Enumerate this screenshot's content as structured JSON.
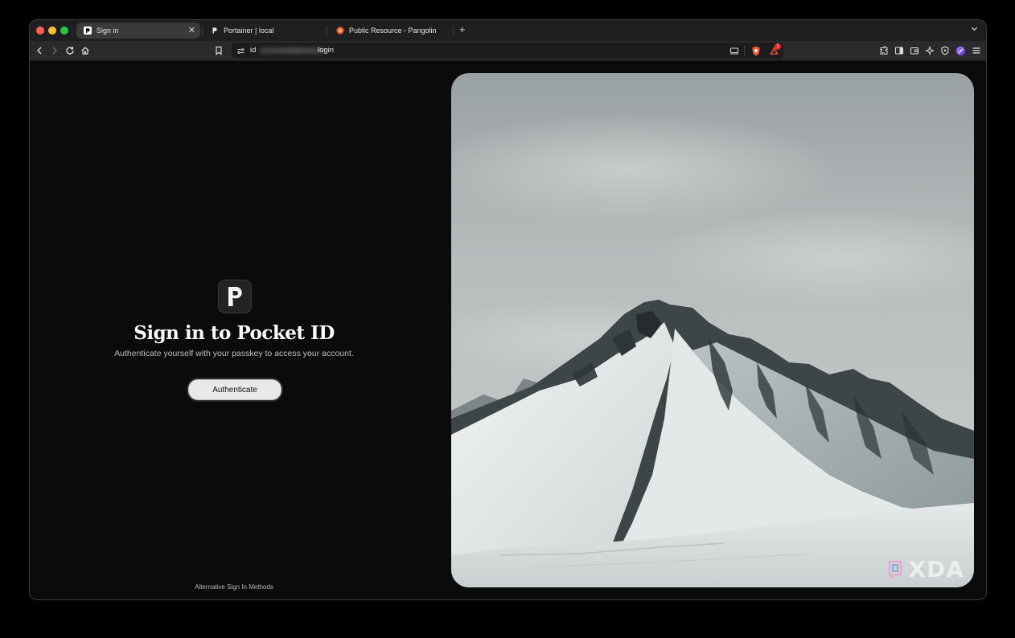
{
  "browser": {
    "tabs": [
      {
        "label": "Sign in",
        "active": true
      },
      {
        "label": "Portainer | local",
        "active": false
      },
      {
        "label": "Public Resource - Pangolin",
        "active": false
      }
    ],
    "url_prefix": "id",
    "url_path": "login",
    "shield_badge": "1",
    "colors": {
      "window_bg": "#0b0b0c",
      "tabstrip_bg": "#1f1f21",
      "toolbar_bg": "#2a2a2c",
      "brave_orange": "#fb542b"
    }
  },
  "login": {
    "title": "Sign in to Pocket ID",
    "subtitle": "Authenticate yourself with your passkey to access your account.",
    "authenticate_label": "Authenticate",
    "alternative_label": "Alternative Sign In Methods"
  },
  "watermark": {
    "text": "XDA"
  },
  "icons": [
    "back-icon",
    "forward-icon",
    "reload-icon",
    "home-icon",
    "bookmark-icon",
    "site-settings-icon",
    "cast-icon",
    "brave-shield-icon",
    "rewards-icon",
    "extensions-icon",
    "sidebar-icon",
    "wallet-icon",
    "leo-ai-icon",
    "vpn-icon",
    "profile-icon",
    "menu-icon"
  ]
}
